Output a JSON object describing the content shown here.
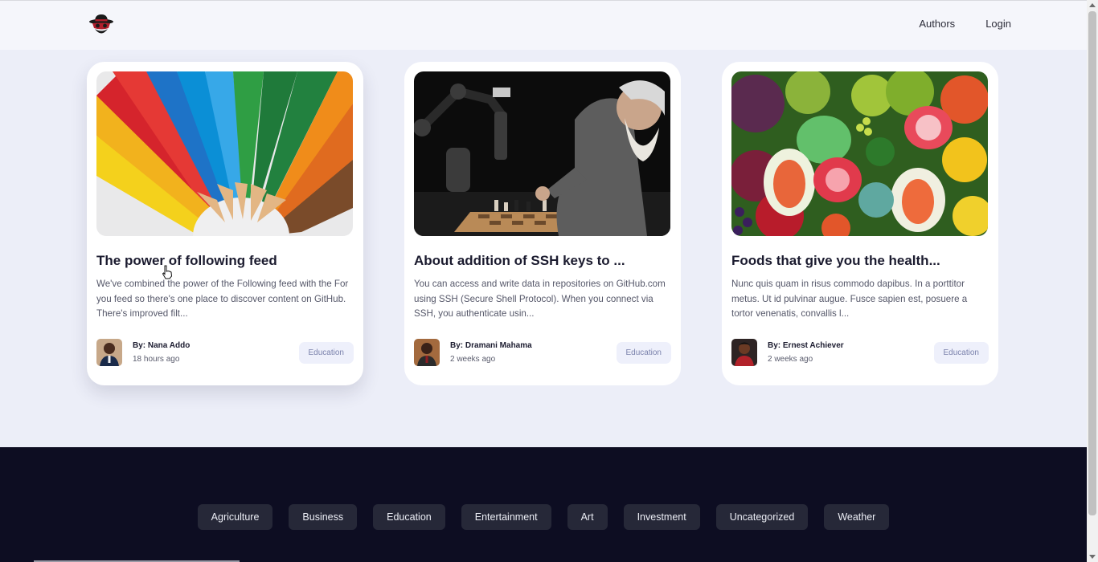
{
  "header": {
    "logo_icon": "spy-hat-logo-icon",
    "nav": [
      {
        "label": "Authors"
      },
      {
        "label": "Login"
      }
    ]
  },
  "cards": [
    {
      "image": "colored-pencils-image",
      "title": "The power of following feed",
      "excerpt": "We've combined the power of the Following feed with the For you feed so there's one place to discover content on GitHub. There's improved filt...",
      "author": "By: Nana Addo",
      "time": "18 hours ago",
      "tag": "Education"
    },
    {
      "image": "robot-chess-image",
      "title": "About addition of SSH keys to ...",
      "excerpt": "You can access and write data in repositories on GitHub.com using SSH (Secure Shell Protocol). When you connect via SSH, you authenticate usin...",
      "author": "By: Dramani Mahama",
      "time": "2 weeks ago",
      "tag": "Education"
    },
    {
      "image": "fruits-image",
      "title": "Foods that give you the health...",
      "excerpt": "Nunc quis quam in risus commodo dapibus. In a porttitor metus. Ut id pulvinar augue. Fusce sapien est, posuere a tortor venenatis, convallis l...",
      "author": "By: Ernest Achiever",
      "time": "2 weeks ago",
      "tag": "Education"
    }
  ],
  "footer": {
    "categories": [
      {
        "label": "Agriculture"
      },
      {
        "label": "Business"
      },
      {
        "label": "Education"
      },
      {
        "label": "Entertainment"
      },
      {
        "label": "Art"
      },
      {
        "label": "Investment"
      },
      {
        "label": "Uncategorized"
      },
      {
        "label": "Weather"
      }
    ]
  },
  "colors": {
    "page_bg": "#eceef8",
    "footer_bg": "#0d0d22",
    "tag_bg": "#eef0fb",
    "tag_text": "#7b82ac",
    "category_bg": "#262838"
  }
}
